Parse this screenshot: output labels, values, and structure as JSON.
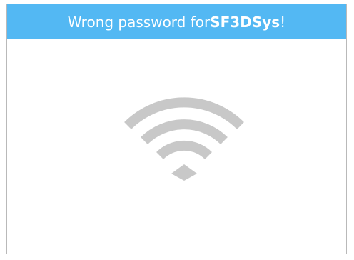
{
  "message": {
    "prefix": "Wrong password for ",
    "network_name": "SF3DSys",
    "suffix": "!"
  },
  "icon": {
    "name": "wifi-icon",
    "color": "#c8c8c8"
  },
  "colors": {
    "banner": "#53b8f3",
    "banner_text": "#ffffff",
    "border": "#b9b9b9"
  }
}
